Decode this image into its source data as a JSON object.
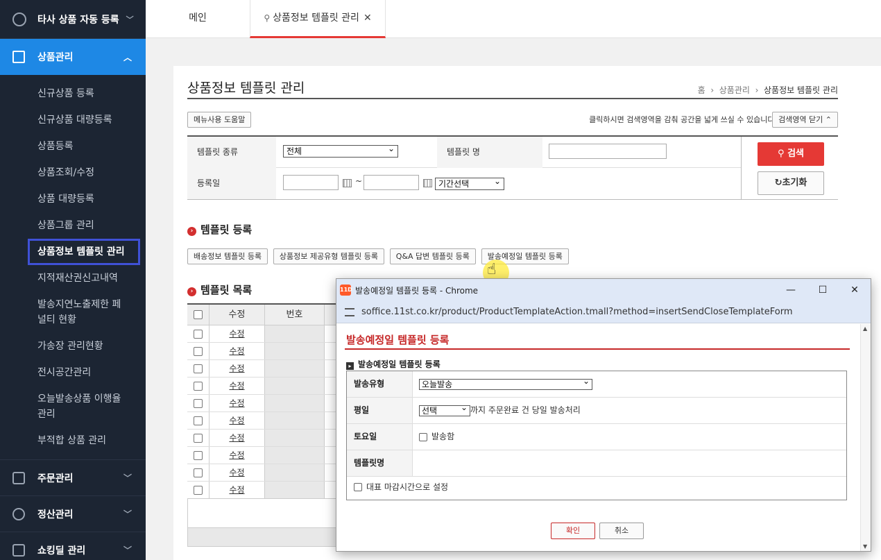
{
  "sidebar": {
    "top_item": "타사 상품 자동 등록",
    "active_group": "상품관리",
    "sub_items": [
      "신규상품 등록",
      "신규상품 대량등록",
      "상품등록",
      "상품조회/수정",
      "상품 대량등록",
      "상품그룹 관리",
      "상품정보 템플릿 관리",
      "지적재산권신고내역",
      "발송지연노출제한 페널티 현황",
      "가송장 관리현황",
      "전시공간관리",
      "오늘발송상품 이행율관리",
      "부적합 상품 관리"
    ],
    "groups": [
      "주문관리",
      "정산관리",
      "쇼킹딜 관리"
    ]
  },
  "tabs": {
    "main": "메인",
    "current": "상품정보 템플릿 관리"
  },
  "page": {
    "title": "상품정보 템플릿 관리",
    "breadcrumb": [
      "홈",
      "상품관리",
      "상품정보 템플릿 관리"
    ],
    "help_button": "메뉴사용 도움말",
    "hint": "클릭하시면 검색영역을 감춰 공간을 넓게 쓰실 수 있습니다.",
    "collapse_button": "검색영역 닫기",
    "search": {
      "type_label": "템플릿 종류",
      "type_value": "전체",
      "name_label": "템플릿 명",
      "date_label": "등록일",
      "date_tilde": "~",
      "period_value": "기간선택",
      "search_button": "검색",
      "reset_button": "초기화"
    },
    "register_title": "템플릿 등록",
    "register_buttons": [
      "배송정보 템플릿 등록",
      "상품정보 제공유형 템플릿 등록",
      "Q&A 답변 템플릿 등록",
      "발송예정일 템플릿 등록"
    ],
    "list_title": "템플릿 목록",
    "list_headers": {
      "edit": "수정",
      "number": "번호"
    },
    "list_rows": [
      "수정",
      "수정",
      "수정",
      "수정",
      "수정",
      "수정",
      "수정",
      "수정",
      "수정",
      "수정"
    ]
  },
  "popup": {
    "window_title": "발송예정일 템플릿 등록 - Chrome",
    "logo": "11D",
    "url": "soffice.11st.co.kr/product/ProductTemplateAction.tmall?method=insertSendCloseTemplateForm",
    "heading": "발송예정일 템플릿 등록",
    "subheading": "발송예정일 템플릿 등록",
    "form": {
      "ship_type_label": "발송유형",
      "ship_type_value": "오늘발송",
      "weekday_label": "평일",
      "weekday_select": "선택",
      "weekday_text": "까지 주문완료 건 당일 발송처리",
      "saturday_label": "토요일",
      "saturday_check": "발송함",
      "template_name_label": "템플릿명",
      "default_check": "대표 마감시간으로 설정"
    },
    "ok_button": "확인",
    "cancel_button": "취소"
  }
}
